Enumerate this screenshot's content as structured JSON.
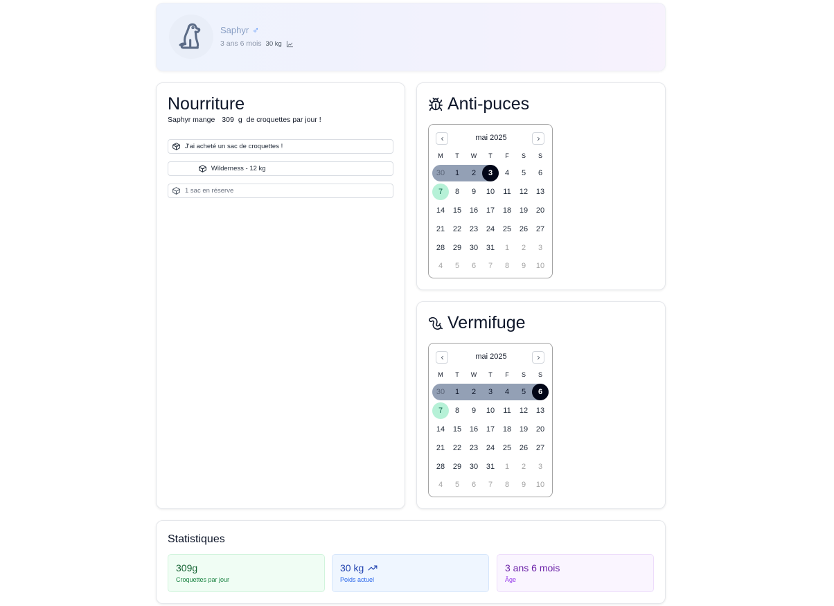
{
  "profile": {
    "name": "Saphyr",
    "gender_symbol": "♂",
    "age": "3 ans 6 mois",
    "weight": "30 kg",
    "avatar_icon": "dog-icon",
    "weight_chart_icon": "chart-icon"
  },
  "food": {
    "title": "Nourriture",
    "sentence_prefix": "Saphyr mange",
    "amount": "309",
    "unit": "g",
    "sentence_suffix": "de croquettes par jour !",
    "actions": [
      {
        "label": "J'ai acheté un sac de croquettes !",
        "icon": "package-icon"
      },
      {
        "label": "Wilderness - 12 kg",
        "icon": "package-open-icon",
        "progress_fraction": 0.1
      },
      {
        "label": "1 sac en réserve",
        "icon": "package-icon"
      }
    ]
  },
  "flea": {
    "title": "Anti-puces",
    "icon": "bug-icon",
    "calendar": {
      "month": "mai 2025",
      "weekdays": [
        "M",
        "T",
        "W",
        "T",
        "F",
        "S",
        "S"
      ],
      "range_start": "30",
      "range_end": "3",
      "selected": "3",
      "today": "7"
    }
  },
  "worm": {
    "title": "Vermifuge",
    "icon": "worm-icon",
    "calendar": {
      "month": "mai 2025",
      "weekdays": [
        "M",
        "T",
        "W",
        "T",
        "F",
        "S",
        "S"
      ],
      "range_start": "30",
      "range_end": "6",
      "selected": "6",
      "today": "7"
    }
  },
  "calendar_weeks": [
    [
      {
        "d": "30",
        "m": true
      },
      {
        "d": "1"
      },
      {
        "d": "2"
      },
      {
        "d": "3"
      },
      {
        "d": "4"
      },
      {
        "d": "5"
      },
      {
        "d": "6"
      }
    ],
    [
      {
        "d": "7"
      },
      {
        "d": "8"
      },
      {
        "d": "9"
      },
      {
        "d": "10"
      },
      {
        "d": "11"
      },
      {
        "d": "12"
      },
      {
        "d": "13"
      }
    ],
    [
      {
        "d": "14"
      },
      {
        "d": "15"
      },
      {
        "d": "16"
      },
      {
        "d": "17"
      },
      {
        "d": "18"
      },
      {
        "d": "19"
      },
      {
        "d": "20"
      }
    ],
    [
      {
        "d": "21"
      },
      {
        "d": "22"
      },
      {
        "d": "23"
      },
      {
        "d": "24"
      },
      {
        "d": "25"
      },
      {
        "d": "26"
      },
      {
        "d": "27"
      }
    ],
    [
      {
        "d": "28"
      },
      {
        "d": "29"
      },
      {
        "d": "30"
      },
      {
        "d": "31"
      },
      {
        "d": "1",
        "m": true
      },
      {
        "d": "2",
        "m": true
      },
      {
        "d": "3",
        "m": true
      }
    ],
    [
      {
        "d": "4",
        "m": true
      },
      {
        "d": "5",
        "m": true
      },
      {
        "d": "6",
        "m": true
      },
      {
        "d": "7",
        "m": true
      },
      {
        "d": "8",
        "m": true
      },
      {
        "d": "9",
        "m": true
      },
      {
        "d": "10",
        "m": true
      }
    ]
  ],
  "stats": {
    "title": "Statistiques",
    "items": [
      {
        "value": "309g",
        "label": "Croquettes par jour"
      },
      {
        "value": "30 kg",
        "label": "Poids actuel",
        "icon": "trending-up-icon"
      },
      {
        "value": "3 ans 6 mois",
        "label": "Âge"
      }
    ]
  }
}
